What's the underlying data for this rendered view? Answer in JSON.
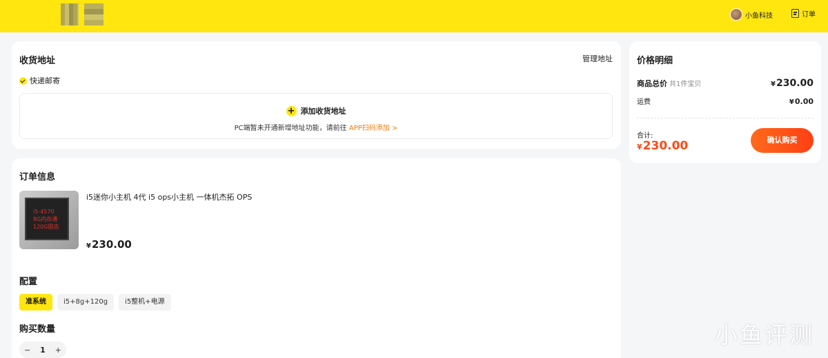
{
  "header": {
    "username": "小鱼科技",
    "orders_label": "订单"
  },
  "address": {
    "title": "收货地址",
    "manage_label": "管理地址",
    "delivery_method": "快递邮寄",
    "add_label": "添加收货地址",
    "hint_text": "PC端暂未开通新增地址功能，请前往",
    "hint_link": "APP扫码添加 >"
  },
  "order": {
    "title": "订单信息",
    "product_title": "i5迷你小主机 4代 i5 ops小主机 一体机杰拓 OPS",
    "currency": "¥",
    "product_price": "230.00",
    "thumb_lines": [
      "i5-4570",
      "8G内存通",
      "120G固态"
    ],
    "config_title": "配置",
    "config_options": [
      "准系统",
      "i5+8g+120g",
      "i5整机+电源"
    ],
    "config_selected": 0,
    "qty_title": "购买数量",
    "qty_minus": "−",
    "qty_value": "1",
    "qty_plus": "+"
  },
  "price_detail": {
    "title": "价格明细",
    "goods_total_label": "商品总价",
    "goods_count": "共1件宝贝",
    "currency": "¥",
    "goods_total": "230.00",
    "shipping_label": "运费",
    "shipping": "0.00",
    "total_label": "合计:",
    "total": "230.00",
    "buy_label": "确认购买"
  },
  "watermark": "小鱼评测",
  "colors": {
    "brand_yellow": "#ffe60f",
    "accent_orange": "#ff4a16",
    "link_orange": "#f07a0c"
  }
}
